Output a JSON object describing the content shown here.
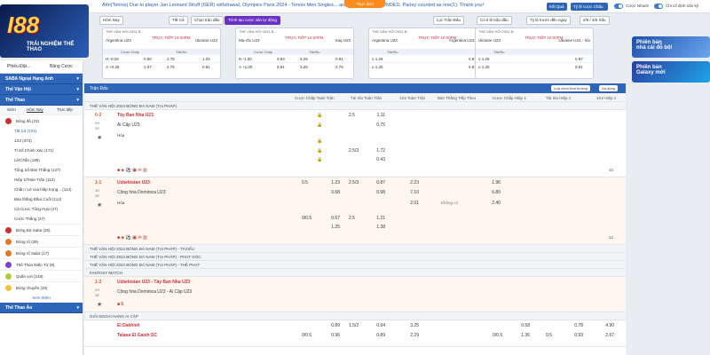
{
  "topbar": {
    "clock": "09:42:03PM July 30, 2024 GMT +7",
    "ticker": "Attn(Tennis) Due to player Jan Leonard Struff (GER) withdrawal, Olympics Paris 2024 - Tennis Men Singles... are considered REFUNDED. Parlay counted as one(1). Thank you!",
    "announce": "Thực đơn",
    "exit": "Kết Quả",
    "odds_type": "Tỷ lệ cược Châu",
    "fast_bet": "Cược Nhanh",
    "auto_refresh": "Chỉ cố định năn kỹ"
  },
  "logo": {
    "main": "I88",
    "sub": "TRẢI NGHIỆM THỂ THAO"
  },
  "filter": {
    "tab": "Hôm Nay",
    "all": "Tất Cả",
    "select": "Chọn trận đấu",
    "trinh": "Trình tạo cược sân tự động",
    "sort": "Lọc Trận Đấu",
    "btn_a": "Có tỉ lệ trận đầu",
    "btn_b": "Tỷ lệ trước đến ngay",
    "btn_c": "2/5 / 4/5 Xấu"
  },
  "cards": [
    {
      "head": "THẾ VẬN HỘI 2024 B...",
      "home": "Argentina U23",
      "away": "Ukraine U23",
      "live": "TRỰC TIẾP 10:00PM",
      "col1": "Cược Chấp",
      "col2": "Tài/Xỉu",
      "r1": [
        "H -0.25",
        "0.80",
        "2.75",
        "1.04"
      ],
      "r2": [
        "A +0.25",
        "1.07",
        "2.75",
        "0.81"
      ]
    },
    {
      "head": "THẾ VẬN HỘI 2024 B...",
      "home": "Ma-rốc U23",
      "away": "Iraq U23",
      "live": "TRỰC TIẾP 10:00PM",
      "col1": "Cược Chấp",
      "col2": "Tài/Xỉu",
      "r1": [
        "H -1.00",
        "0.83",
        "3.25",
        "0.91"
      ],
      "r2": [
        "A +1.00",
        "0.91",
        "3.25",
        "0.79"
      ]
    },
    {
      "head": "THẾ VẬN HỘI 2024 B...",
      "home": "Argentina U23",
      "away": "Argentina U23 - Xỉu",
      "live": "TRỰC TIẾP 10:00PM",
      "col1": "Tài/Xỉu",
      "col2": "",
      "r1": [
        "o 1.25",
        "0.87",
        "",
        ""
      ],
      "r2": [
        "u 1.25",
        "0.81",
        "",
        ""
      ]
    },
    {
      "head": "THẾ VẬN HỘI 2024 B...",
      "home": "Ukraine U23",
      "away": "Ukraine U23 - Xỉu",
      "live": "TRỰC TIẾP 10:00PM",
      "col1": "Tài/Xỉu",
      "col2": "",
      "r1": [
        "o 1.25",
        "0.87",
        "",
        ""
      ],
      "r2": [
        "u 1.25",
        "0.81",
        "",
        ""
      ]
    }
  ],
  "left": {
    "tab_sports": "Phiếu Đặt...",
    "tab_bets": "Bảng Cược",
    "saba": "SABA Ngoại Hạng Anh",
    "thevan": "Thế Vận Hội",
    "thethao": "Thể Thao",
    "subtabs": [
      "Sớm",
      "Hôm Nay",
      "Trực tiếp"
    ],
    "soccer": "Bóng đá (23)",
    "rows": [
      "Tất Cả (721)",
      "1X2 (373)",
      "Tỉ Số Chính Xác (171)",
      "Lẻ/Chẵn (188)",
      "Tổng Số Bàn Thắng (147)",
      "Hiệp 1/Toàn Trận (114)",
      "Chấn / Lẻ của hiệp trọng... (114)",
      "Bàn thắng Đầu/ Cuối (114)",
      "Cá Cược Tổng Hợp (47)",
      "Cược Thắng (47)"
    ],
    "sports": [
      "Bóng Đá Saba (25)",
      "Bóng rổ (39)",
      "Bóng rổ Saba (17)",
      "Thể Thao Điện Tử (8)",
      "Quần vợt (148)",
      "Bóng chuyền (33)"
    ],
    "more": "Xem thêm",
    "theothao_a": "Thể Thao Ảo"
  },
  "main": {
    "head": "Trận Đấu",
    "sort_select": "Lựa chọn thời hướng",
    "sort_label": "Xa dòng",
    "cols": [
      "Cược Chấp Toàn Trận",
      "Tài Xỉu Toàn Trận",
      "1X2 Toàn Trận",
      "Bàn Thắng Tiếp Theo",
      "Cược Chấp Hiệp 1",
      "Tài Xỉu Hiệp 1",
      "1X2 Hiệp 1"
    ],
    "league1": "THẾ VẬN HỘI 2024 BÓNG ĐÁ NAM (TẠI PHÁP)",
    "e1": {
      "score": "0-2",
      "minute": "2H",
      "period": "39'",
      "home": "Tây Ban Nha U23",
      "away": "Ai Cập U23",
      "draw": "Hòa",
      "r1": [
        "2.5",
        "1.11"
      ],
      "r2": [
        "0.75"
      ],
      "r3": [],
      "r4": [
        "2.5/3",
        "1.72"
      ],
      "r5": [
        "0.43"
      ]
    },
    "page_no": "10",
    "e2": {
      "score": "1-1",
      "minute": "1H",
      "period": "39'",
      "home": "Uzbekistan U23",
      "away": "Cộng hòa Dominica U23",
      "draw": "Hòa",
      "r1": [
        "0.5",
        "1.23",
        "2.5/3",
        "0.87",
        "2.23",
        "1.96"
      ],
      "r2": [
        "0.68",
        "0.98",
        "7.10",
        "6.80"
      ],
      "r3": [
        "2.01",
        "Không có",
        "2.40"
      ],
      "r4": [
        "0/0.5",
        "0.67",
        "2.5",
        "1.21"
      ],
      "r5": [
        "1.25",
        "1.38"
      ]
    },
    "page_no2": "12",
    "grp1": "THẾ VẬN HỘI 2024 BÓNG ĐÁ NAM (TẠI PHÁP) - TÀI/XỈU",
    "grp2": "THẾ VẬN HỘI 2024 BÓNG ĐÁ NAM (TẠI PHÁP) - PHẠT GÓC",
    "grp3": "THẾ VẬN HỘI 2024 BÓNG ĐÁ NAM (TẠI PHÁP) - THẺ PHẠT",
    "fantasy": "FANTASY MATCH",
    "e3": {
      "score": "1-3",
      "minute": "2H",
      "period": "38'",
      "home": "Uzbekistan U23 - Tây Ban Nha U23",
      "away": "Cộng hòa Dominica U23 - Ai Cập U23"
    },
    "league2": "GIẢI NGOẠI HẠNG AI CẬP",
    "e4": {
      "home": "El Dakhleh",
      "away": "Talaea El Gaish SC",
      "r1": [
        "0.89",
        "1.5/2",
        "0.94",
        "3.25",
        "0.58",
        "0.78",
        "4.90"
      ],
      "r2": [
        "0/0.5",
        "0.96",
        "0.89",
        "2.29",
        "0/0.5",
        "1.36",
        "0.5",
        "0.93",
        "2.67"
      ]
    }
  },
  "right": {
    "b1": [
      "Phiên bản",
      "nhà cái đỗ bộ!"
    ],
    "b2": [
      "Phiên bản",
      "Galaxy mới"
    ]
  }
}
